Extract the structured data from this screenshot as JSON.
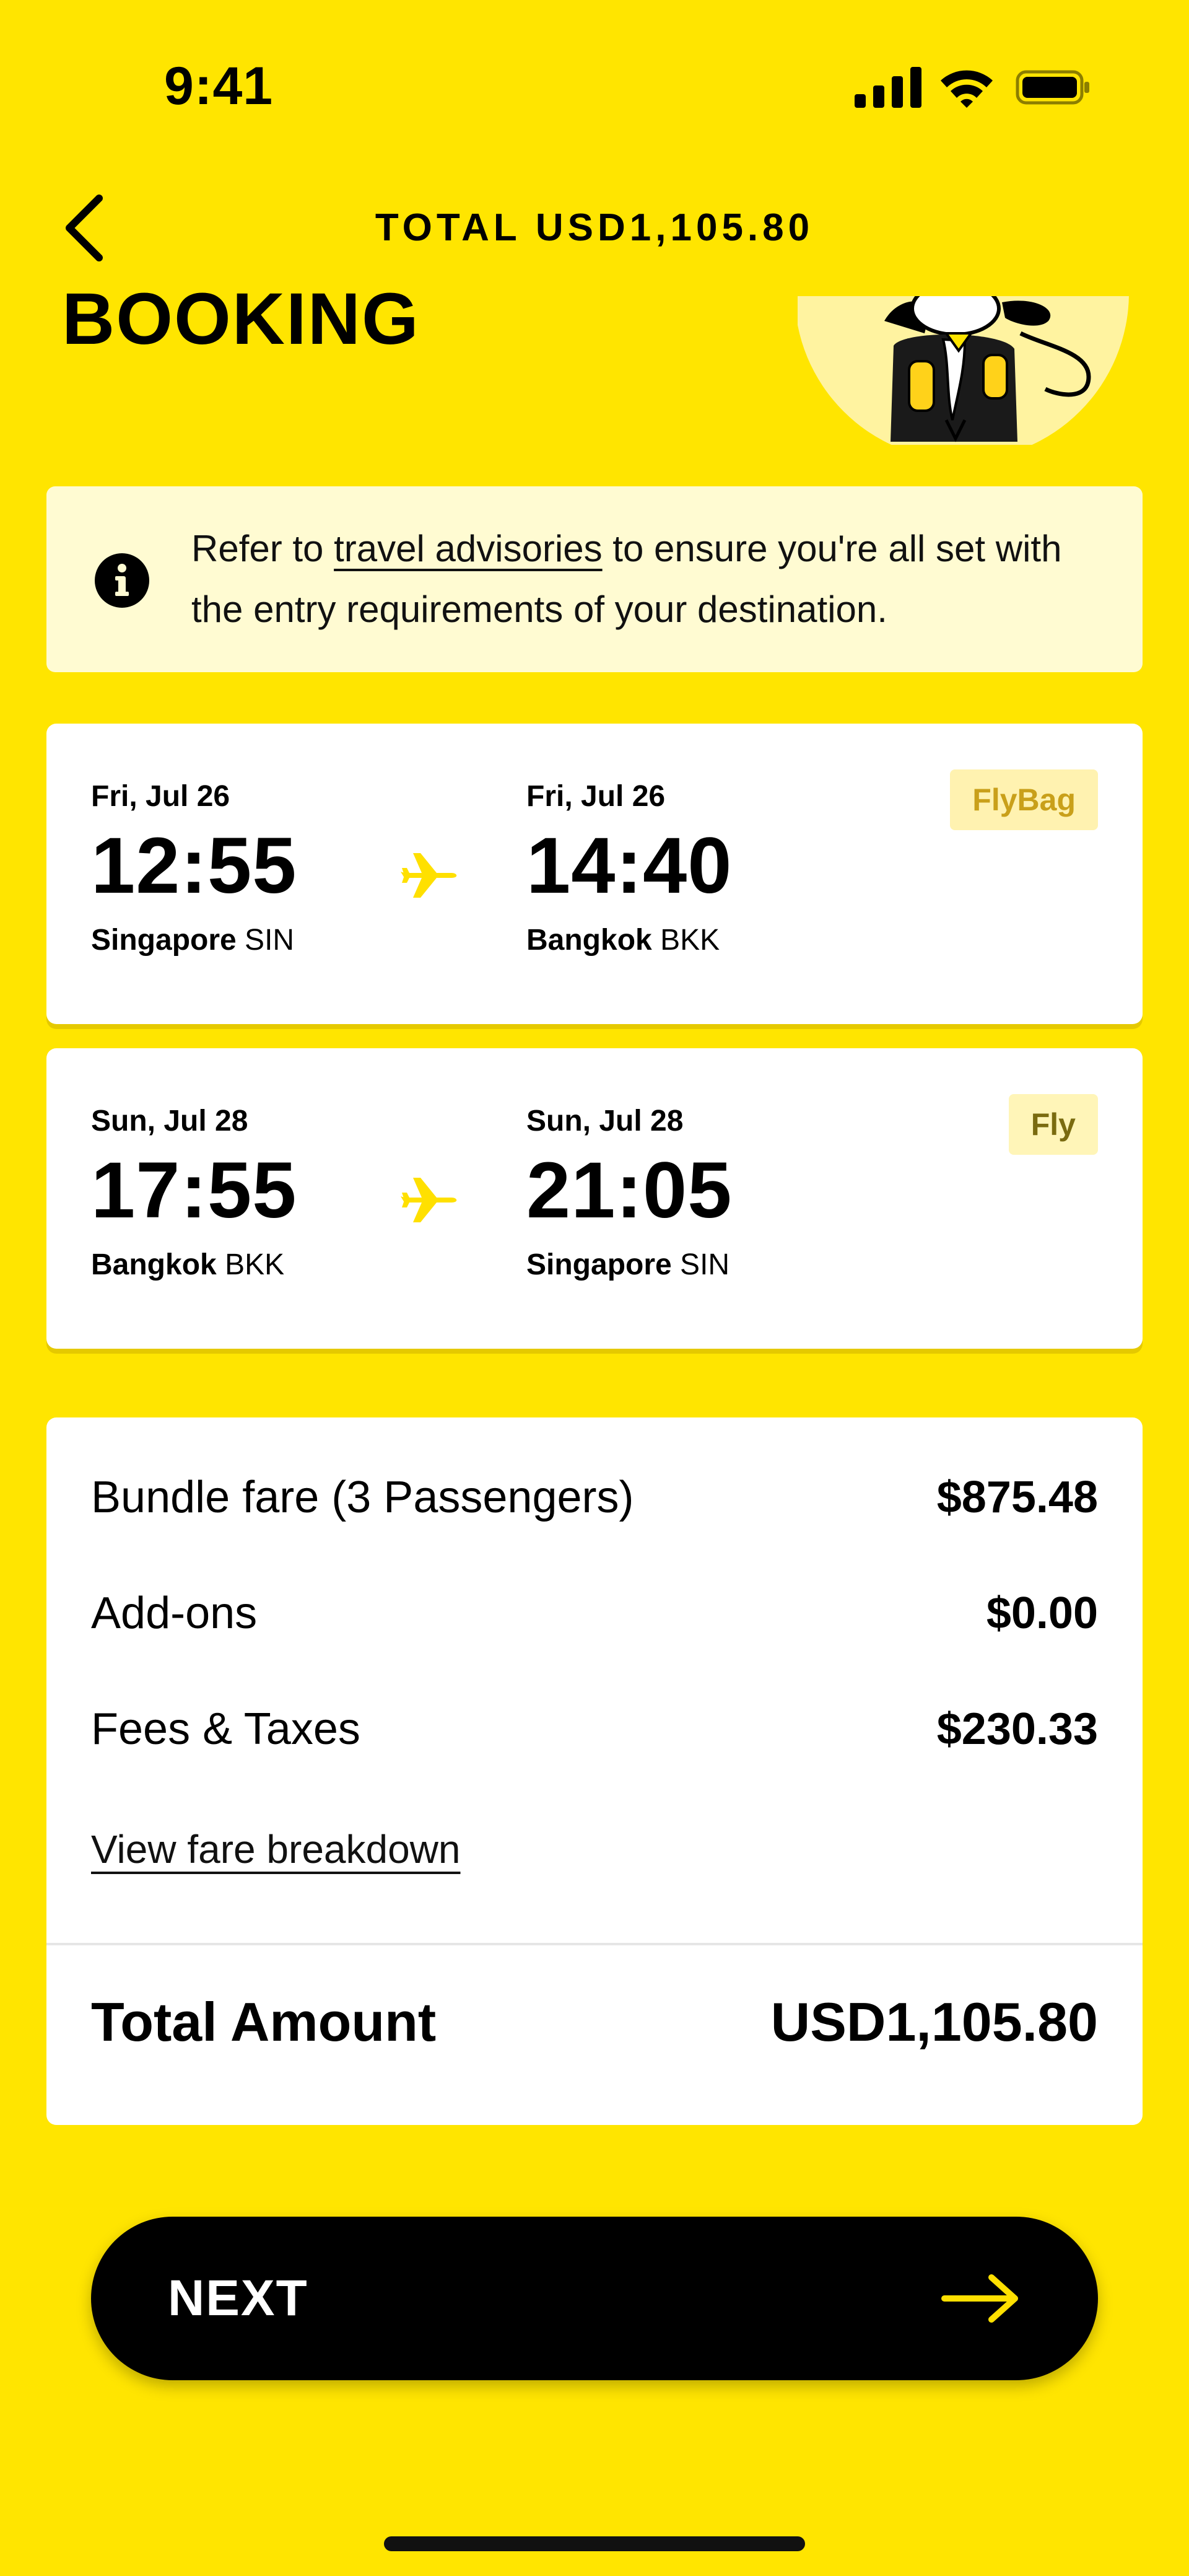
{
  "status_bar": {
    "time": "9:41"
  },
  "header": {
    "total_label": "TOTAL USD1,105.80"
  },
  "page": {
    "title": "BOOKING"
  },
  "advisory": {
    "text_before": "Refer to ",
    "link_text": "travel advisories",
    "text_after": " to ensure you're all set with the entry requirements of your destination."
  },
  "flights": [
    {
      "departure": {
        "date": "Fri, Jul 26",
        "time": "12:55",
        "city": "Singapore",
        "code": "SIN"
      },
      "arrival": {
        "date": "Fri, Jul 26",
        "time": "14:40",
        "city": "Bangkok",
        "code": "BKK"
      },
      "bundle": "FlyBag"
    },
    {
      "departure": {
        "date": "Sun, Jul 28",
        "time": "17:55",
        "city": "Bangkok",
        "code": "BKK"
      },
      "arrival": {
        "date": "Sun, Jul 28",
        "time": "21:05",
        "city": "Singapore",
        "code": "SIN"
      },
      "bundle": "Fly"
    }
  ],
  "fare": {
    "rows": [
      {
        "label": "Bundle fare (3 Passengers)",
        "value": "$875.48"
      },
      {
        "label": "Add-ons",
        "value": "$0.00"
      },
      {
        "label": "Fees & Taxes",
        "value": "$230.33"
      }
    ],
    "breakdown_link": "View fare breakdown",
    "total_label": "Total Amount",
    "total_value": "USD1,105.80"
  },
  "next_button": {
    "label": "NEXT"
  },
  "colors": {
    "brand_yellow": "#FFE500",
    "badge_gold": "#C9A01A",
    "plane_yellow": "#FFE000"
  }
}
